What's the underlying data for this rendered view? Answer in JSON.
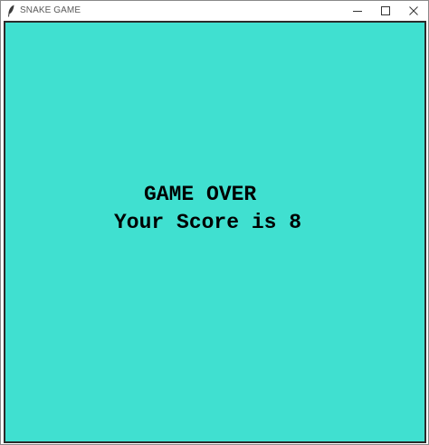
{
  "window": {
    "title": "SNAKE GAME",
    "controls": {
      "minimize_icon": "minimize-icon",
      "maximize_icon": "maximize-icon",
      "close_icon": "close-icon"
    }
  },
  "game": {
    "background_color": "#40e0d0",
    "game_over_text": "GAME OVER",
    "score_text": "Your Score is 8",
    "score": 8
  }
}
